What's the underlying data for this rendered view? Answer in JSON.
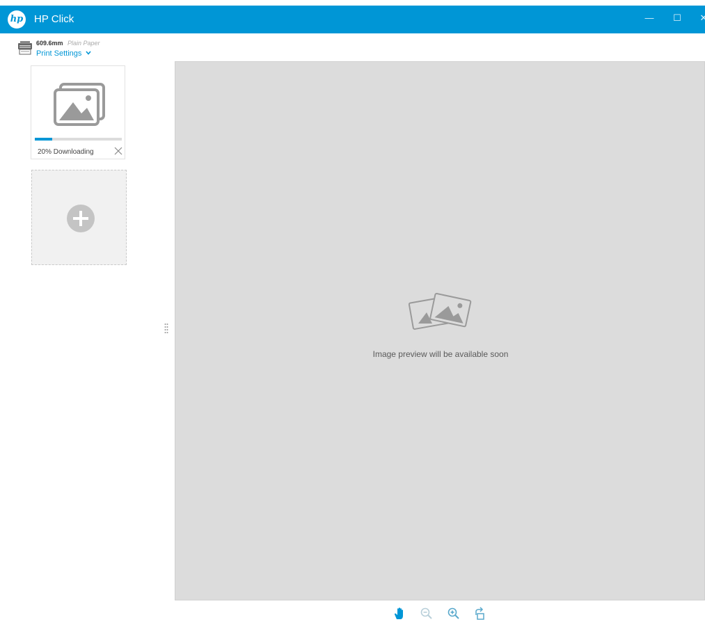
{
  "window": {
    "title": "HP Click",
    "logo_text": "hp",
    "controls": {
      "minimize": "—",
      "maximize": "☐",
      "close": "✕"
    }
  },
  "printer": {
    "paper_size": "609.6mm",
    "paper_type": "Plain Paper",
    "settings_label": "Print Settings",
    "settings_chevron": "chevron-down-icon"
  },
  "job": {
    "progress": 0.2,
    "status": "20% Downloading",
    "thumbnail_icon": "image-stack-icon",
    "cancel_icon": "close-icon"
  },
  "add_job": {
    "icon": "plus-circle-icon"
  },
  "preview": {
    "message": "Image preview will be available soon",
    "icon": "photos-icon"
  },
  "toolbar": {
    "tools": [
      {
        "name": "pan",
        "icon": "hand-icon",
        "enabled": true
      },
      {
        "name": "zoom-out",
        "icon": "zoom-out-icon",
        "enabled": false
      },
      {
        "name": "zoom-in",
        "icon": "zoom-in-icon",
        "enabled": true
      },
      {
        "name": "rotate",
        "icon": "rotate-icon",
        "enabled": true
      }
    ]
  },
  "colors": {
    "accent": "#0096d6",
    "preview_bg": "#dcdcdc",
    "progress_track": "#dcdcdc",
    "icon_gray": "#9a9a9a",
    "tool_disabled": "#b8cfd9"
  }
}
